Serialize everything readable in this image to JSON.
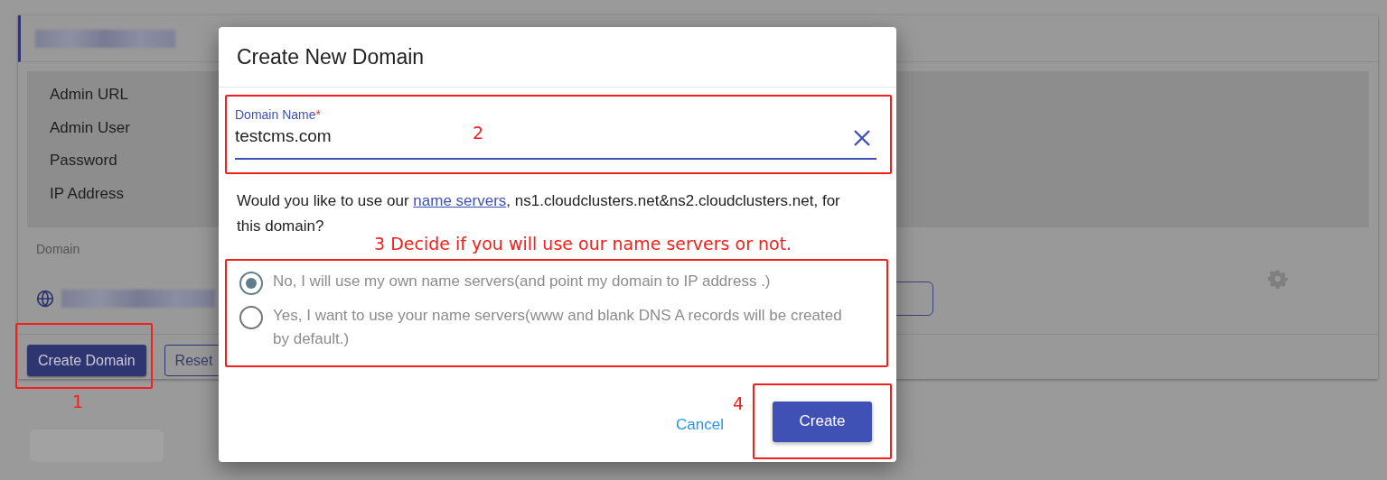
{
  "page": {
    "info_labels": [
      "Admin URL",
      "Admin User",
      "Password",
      "IP Address"
    ],
    "domain_label": "Domain",
    "buttons": [
      "Create Domain",
      "Reset"
    ]
  },
  "dialog": {
    "title": "Create New Domain",
    "field": {
      "label": "Domain Name",
      "required_mark": "*",
      "value": "testcms.com"
    },
    "question": {
      "before": "Would you like to use our",
      "link": "name servers",
      "after": ", ns1.cloudclusters.net&ns2.cloudclusters.net, for this domain?"
    },
    "options": [
      {
        "label": "No, I will use my own name servers(and point my domain to IP address .)",
        "selected": true
      },
      {
        "label": "Yes, I want to use your name servers(www and blank DNS A records will be created by default.)",
        "selected": false
      }
    ],
    "cancel": "Cancel",
    "submit": "Create"
  },
  "annotations": [
    "1",
    "2",
    "3 Decide if you will use our name servers or not.",
    "4"
  ]
}
